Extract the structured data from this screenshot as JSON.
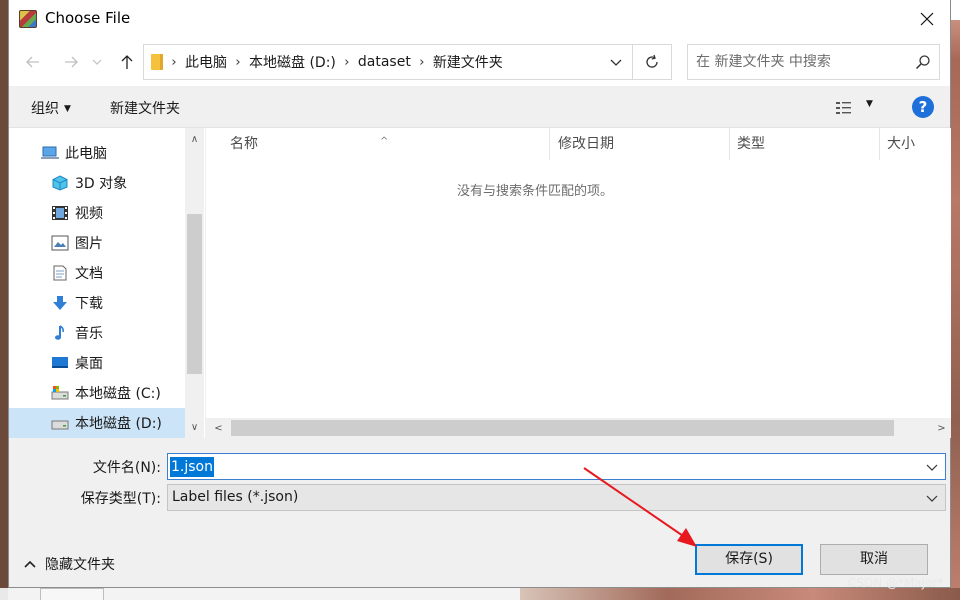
{
  "window": {
    "title": "Choose File"
  },
  "address": {
    "crumbs": [
      "此电脑",
      "本地磁盘 (D:)",
      "dataset",
      "新建文件夹"
    ]
  },
  "search": {
    "placeholder": "在 新建文件夹 中搜索"
  },
  "toolbar": {
    "organize_label": "组织",
    "new_folder_label": "新建文件夹",
    "help_label": "?"
  },
  "sidebar": {
    "items": [
      {
        "label": "此电脑",
        "icon": "computer-icon"
      },
      {
        "label": "3D 对象",
        "icon": "cube-3d-icon"
      },
      {
        "label": "视频",
        "icon": "video-icon"
      },
      {
        "label": "图片",
        "icon": "picture-icon"
      },
      {
        "label": "文档",
        "icon": "document-icon"
      },
      {
        "label": "下载",
        "icon": "download-icon"
      },
      {
        "label": "音乐",
        "icon": "music-icon"
      },
      {
        "label": "桌面",
        "icon": "desktop-icon"
      },
      {
        "label": "本地磁盘 (C:)",
        "icon": "drive-icon"
      },
      {
        "label": "本地磁盘 (D:)",
        "icon": "drive-icon",
        "selected": true
      }
    ]
  },
  "filelist": {
    "columns": [
      "名称",
      "修改日期",
      "类型",
      "大小"
    ],
    "empty_message": "没有与搜索条件匹配的项。"
  },
  "form": {
    "filename_label": "文件名(N):",
    "filename_value": "1.json",
    "filetype_label": "保存类型(T):",
    "filetype_value": "Label files (*.json)"
  },
  "footer": {
    "hide_folders_label": "隐藏文件夹",
    "save_label": "保存(S)",
    "cancel_label": "取消"
  },
  "overlay": {
    "watermark": "CSDN @*Major*"
  },
  "colors": {
    "accent": "#0078d7",
    "selection": "#cce4f7",
    "annotation_arrow": "#e8191e"
  }
}
